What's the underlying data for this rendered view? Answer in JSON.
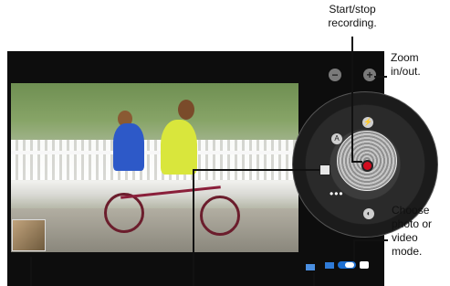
{
  "labels": {
    "record": "Start/stop recording.",
    "zoom": "Zoom in/out.",
    "mode": "Choose photo or video mode."
  },
  "controls": {
    "zoom_minus": "−",
    "zoom_plus": "+",
    "flash": "⚡",
    "auto": "A",
    "theme": "◐",
    "more": "•••"
  },
  "colors": {
    "record": "#d30c1e",
    "mode_accent": "#1c6fd2"
  }
}
